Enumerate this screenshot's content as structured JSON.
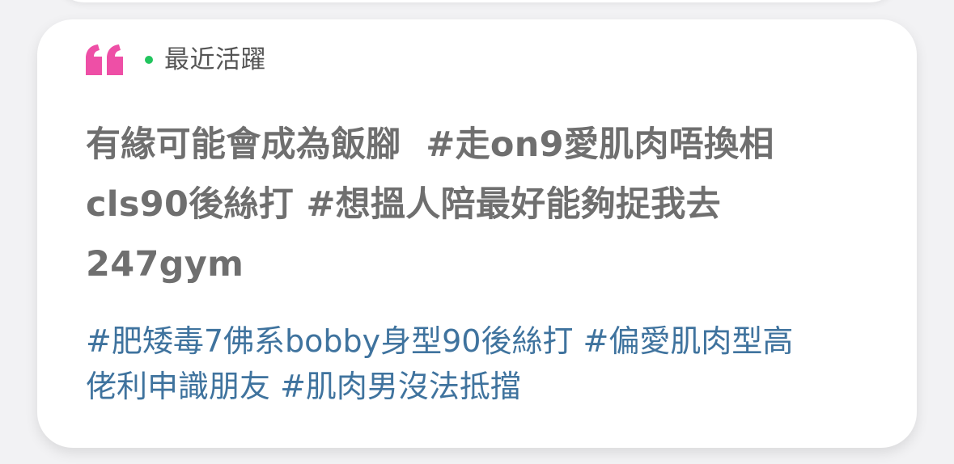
{
  "card": {
    "status_label": "最近活躍",
    "status_color": "#22c55e",
    "accent_color": "#ee4fa6",
    "quote_icon": "quote-icon",
    "text_line_1": "有緣可能會成為飯腳  #走on9愛肌肉唔換相",
    "text_line_2": "cls90後絲打 #想搵人陪最好能夠捉我去",
    "text_line_3": "247gym",
    "tags_line_1": "#肥矮毒7佛系bobby身型90後絲打 #偏愛肌肉型高",
    "tags_line_2": "佬利申識朋友 #肌肉男沒法抵擋"
  }
}
